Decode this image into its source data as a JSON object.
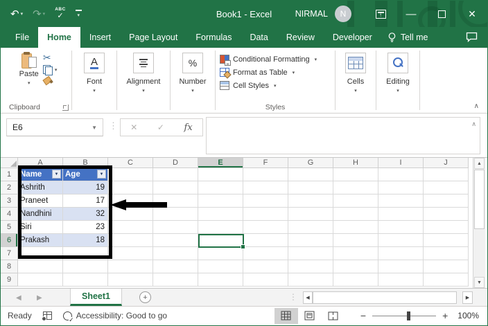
{
  "colors": {
    "excel_green": "#217346",
    "table_header_blue": "#4472C4",
    "banded_row": "#D9E1F2",
    "annotation": "#000000"
  },
  "title_bar": {
    "title": "Book1 - Excel",
    "user": "NIRMAL",
    "avatar_initial": "N"
  },
  "tabs": {
    "items": [
      "File",
      "Home",
      "Insert",
      "Page Layout",
      "Formulas",
      "Data",
      "Review",
      "Developer"
    ],
    "active": "Home",
    "tell_me": "Tell me"
  },
  "ribbon": {
    "paste_label": "Paste",
    "font_symbol": "A",
    "number_symbol": "%",
    "styles_items": [
      "Conditional Formatting",
      "Format as Table",
      "Cell Styles"
    ],
    "groups": {
      "clipboard": "Clipboard",
      "font": "Font",
      "alignment": "Alignment",
      "number": "Number",
      "styles": "Styles",
      "cells": "Cells",
      "editing": "Editing"
    }
  },
  "formula_bar": {
    "name_box": "E6",
    "fx_label": "fx",
    "formula_value": ""
  },
  "grid": {
    "col_headers": [
      "A",
      "B",
      "C",
      "D",
      "E",
      "F",
      "G",
      "H",
      "I",
      "J"
    ],
    "row_headers": [
      "1",
      "2",
      "3",
      "4",
      "5",
      "6",
      "7",
      "8",
      "9"
    ],
    "selected_col": "E",
    "selected_row": "6",
    "active_cell": "E6",
    "table_columns": [
      "A",
      "B"
    ],
    "table_header_row": "1",
    "cells": {
      "A1": "Name",
      "B1": "Age",
      "A2": "Ashrith",
      "B2": "19",
      "A3": "Praneet",
      "B3": "17",
      "A4": "Nandhini",
      "B4": "32",
      "A5": "Siri",
      "B5": "23",
      "A6": "Prakash",
      "B6": "18"
    }
  },
  "sheet_bar": {
    "active_tab": "Sheet1"
  },
  "status_bar": {
    "mode": "Ready",
    "accessibility": "Accessibility: Good to go",
    "zoom_level": "100%"
  }
}
